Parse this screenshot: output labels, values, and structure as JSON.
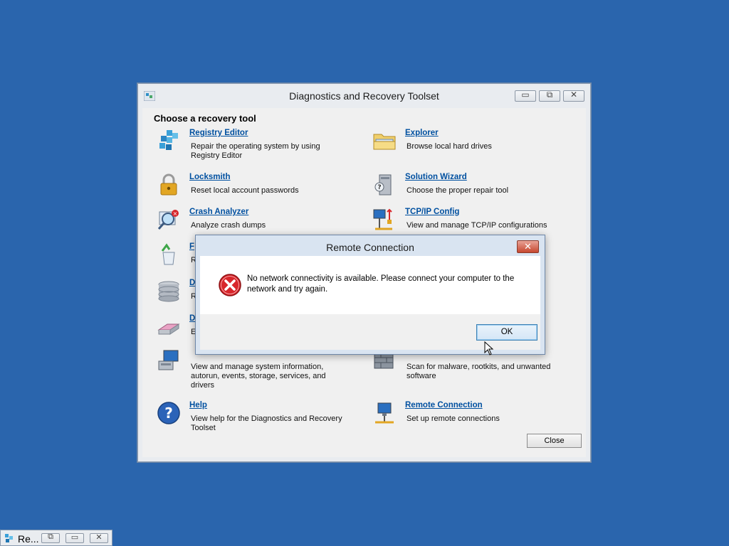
{
  "window": {
    "title": "Diagnostics and Recovery Toolset",
    "controls": {
      "minimize": "▭",
      "maximize": "⧉",
      "close": "✕"
    },
    "heading": "Choose a recovery tool",
    "close_label": "Close"
  },
  "tools": {
    "registry_editor": {
      "name": "Registry Editor",
      "desc": "Repair the operating system by using Registry Editor",
      "icon": "registry-icon"
    },
    "explorer": {
      "name": "Explorer",
      "desc": "Browse local hard drives",
      "icon": "folder-icon"
    },
    "locksmith": {
      "name": "Locksmith",
      "desc": "Reset local account passwords",
      "icon": "padlock-icon"
    },
    "solution_wizard": {
      "name": "Solution Wizard",
      "desc": "Choose the proper repair tool",
      "icon": "wizard-icon"
    },
    "crash_analyzer": {
      "name": "Crash Analyzer",
      "desc": "Analyze crash dumps",
      "icon": "magnifier-icon"
    },
    "tcpip_config": {
      "name": "TCP/IP Config",
      "desc": "View and manage TCP/IP configurations",
      "icon": "network-config-icon"
    },
    "file_restore": {
      "name": "F",
      "desc": "R",
      "icon": "recycle-bin-icon"
    },
    "disk_commander": {
      "name": "D",
      "desc": "R",
      "icon": "disk-stack-icon"
    },
    "disk_wipe": {
      "name": "D",
      "desc": "E",
      "icon": "eraser-icon"
    },
    "computer_management": {
      "name": "",
      "desc": "View and manage system information, autorun, events, storage, services, and drivers",
      "icon": "computer-management-icon"
    },
    "standalone_system_sweeper": {
      "name": "",
      "desc": "Scan for malware, rootkits, and unwanted software",
      "icon": "firewall-icon"
    },
    "help": {
      "name": "Help",
      "desc": "View help for the Diagnostics and Recovery Toolset",
      "icon": "help-icon"
    },
    "remote_connection": {
      "name": "Remote Connection",
      "desc": "Set up remote connections",
      "icon": "remote-monitor-icon"
    }
  },
  "dialog": {
    "title": "Remote Connection",
    "close_glyph": "✕",
    "message": "No network connectivity is available. Please connect your computer to the network and try again.",
    "ok_label": "OK",
    "icon": "error-icon"
  },
  "taskbar": {
    "label": "Re...",
    "controls": {
      "restore": "⧉",
      "maximize": "▭",
      "close": "✕"
    }
  },
  "colors": {
    "desktop": "#2a65ad",
    "link": "#0050a0",
    "error": "#d8262b"
  }
}
